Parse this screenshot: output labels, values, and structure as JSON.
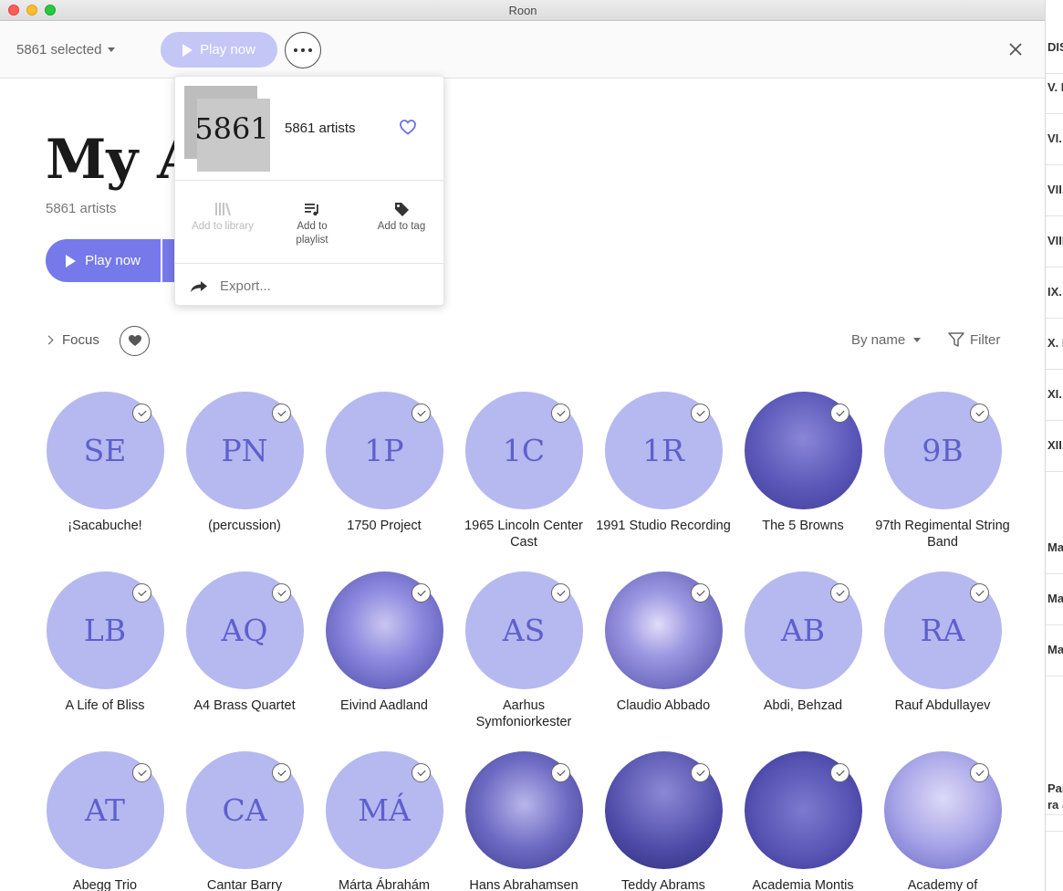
{
  "window": {
    "title": "Roon"
  },
  "selection_bar": {
    "count_label": "5861 selected",
    "play_now": "Play now"
  },
  "page": {
    "title": "My Artists",
    "subtitle": "5861 artists",
    "play_now": "Play now"
  },
  "popup": {
    "stack_number": "5861",
    "title": "5861 artists",
    "actions": [
      {
        "label": "Add to library",
        "enabled": false,
        "icon": "library-icon"
      },
      {
        "label": "Add to playlist",
        "enabled": true,
        "icon": "playlist-icon"
      },
      {
        "label": "Add to tag",
        "enabled": true,
        "icon": "tag-icon"
      }
    ],
    "export_label": "Export..."
  },
  "toolbar": {
    "focus_label": "Focus",
    "sort_label": "By name",
    "filter_label": "Filter"
  },
  "colors": {
    "accent": "#7679ea",
    "accent_light": "#c4c6f5",
    "avatar_bg": "#b6b8f0",
    "avatar_text": "#5d60cc"
  },
  "artists": [
    {
      "name": "¡Sacabuche!",
      "initials": "SE",
      "photo": false
    },
    {
      "name": "(percussion)",
      "initials": "PN",
      "photo": false
    },
    {
      "name": "1750 Project",
      "initials": "1P",
      "photo": false
    },
    {
      "name": "1965 Lincoln Center Cast",
      "initials": "1C",
      "photo": false
    },
    {
      "name": "1991 Studio Recording",
      "initials": "1R",
      "photo": false
    },
    {
      "name": "The 5 Browns",
      "initials": "",
      "photo": true
    },
    {
      "name": "97th Regimental String Band",
      "initials": "9B",
      "photo": false
    },
    {
      "name": "A Life of Bliss",
      "initials": "LB",
      "photo": false
    },
    {
      "name": "A4 Brass Quartet",
      "initials": "AQ",
      "photo": false
    },
    {
      "name": "Eivind Aadland",
      "initials": "",
      "photo": true
    },
    {
      "name": "Aarhus Symfoniorkester",
      "initials": "AS",
      "photo": false
    },
    {
      "name": "Claudio Abbado",
      "initials": "",
      "photo": true
    },
    {
      "name": "Abdi, Behzad",
      "initials": "AB",
      "photo": false
    },
    {
      "name": "Rauf Abdullayev",
      "initials": "RA",
      "photo": false
    },
    {
      "name": "Abegg Trio",
      "initials": "AT",
      "photo": false
    },
    {
      "name": "Cantar Barry",
      "initials": "CA",
      "photo": false
    },
    {
      "name": "Márta Ábrahám",
      "initials": "MÁ",
      "photo": false
    },
    {
      "name": "Hans Abrahamsen",
      "initials": "",
      "photo": true
    },
    {
      "name": "Teddy Abrams",
      "initials": "",
      "photo": true
    },
    {
      "name": "Academia Montis",
      "initials": "",
      "photo": true
    },
    {
      "name": "Academy of",
      "initials": "",
      "photo": true
    }
  ],
  "background_window": {
    "rows": [
      "DISC",
      "V. F",
      "VI. C",
      "VII.",
      "VIII",
      "IX. C",
      "X. F",
      "XI. C",
      "XII.",
      "Maj",
      "Maj",
      "Maj",
      "Par",
      "ra &"
    ]
  }
}
